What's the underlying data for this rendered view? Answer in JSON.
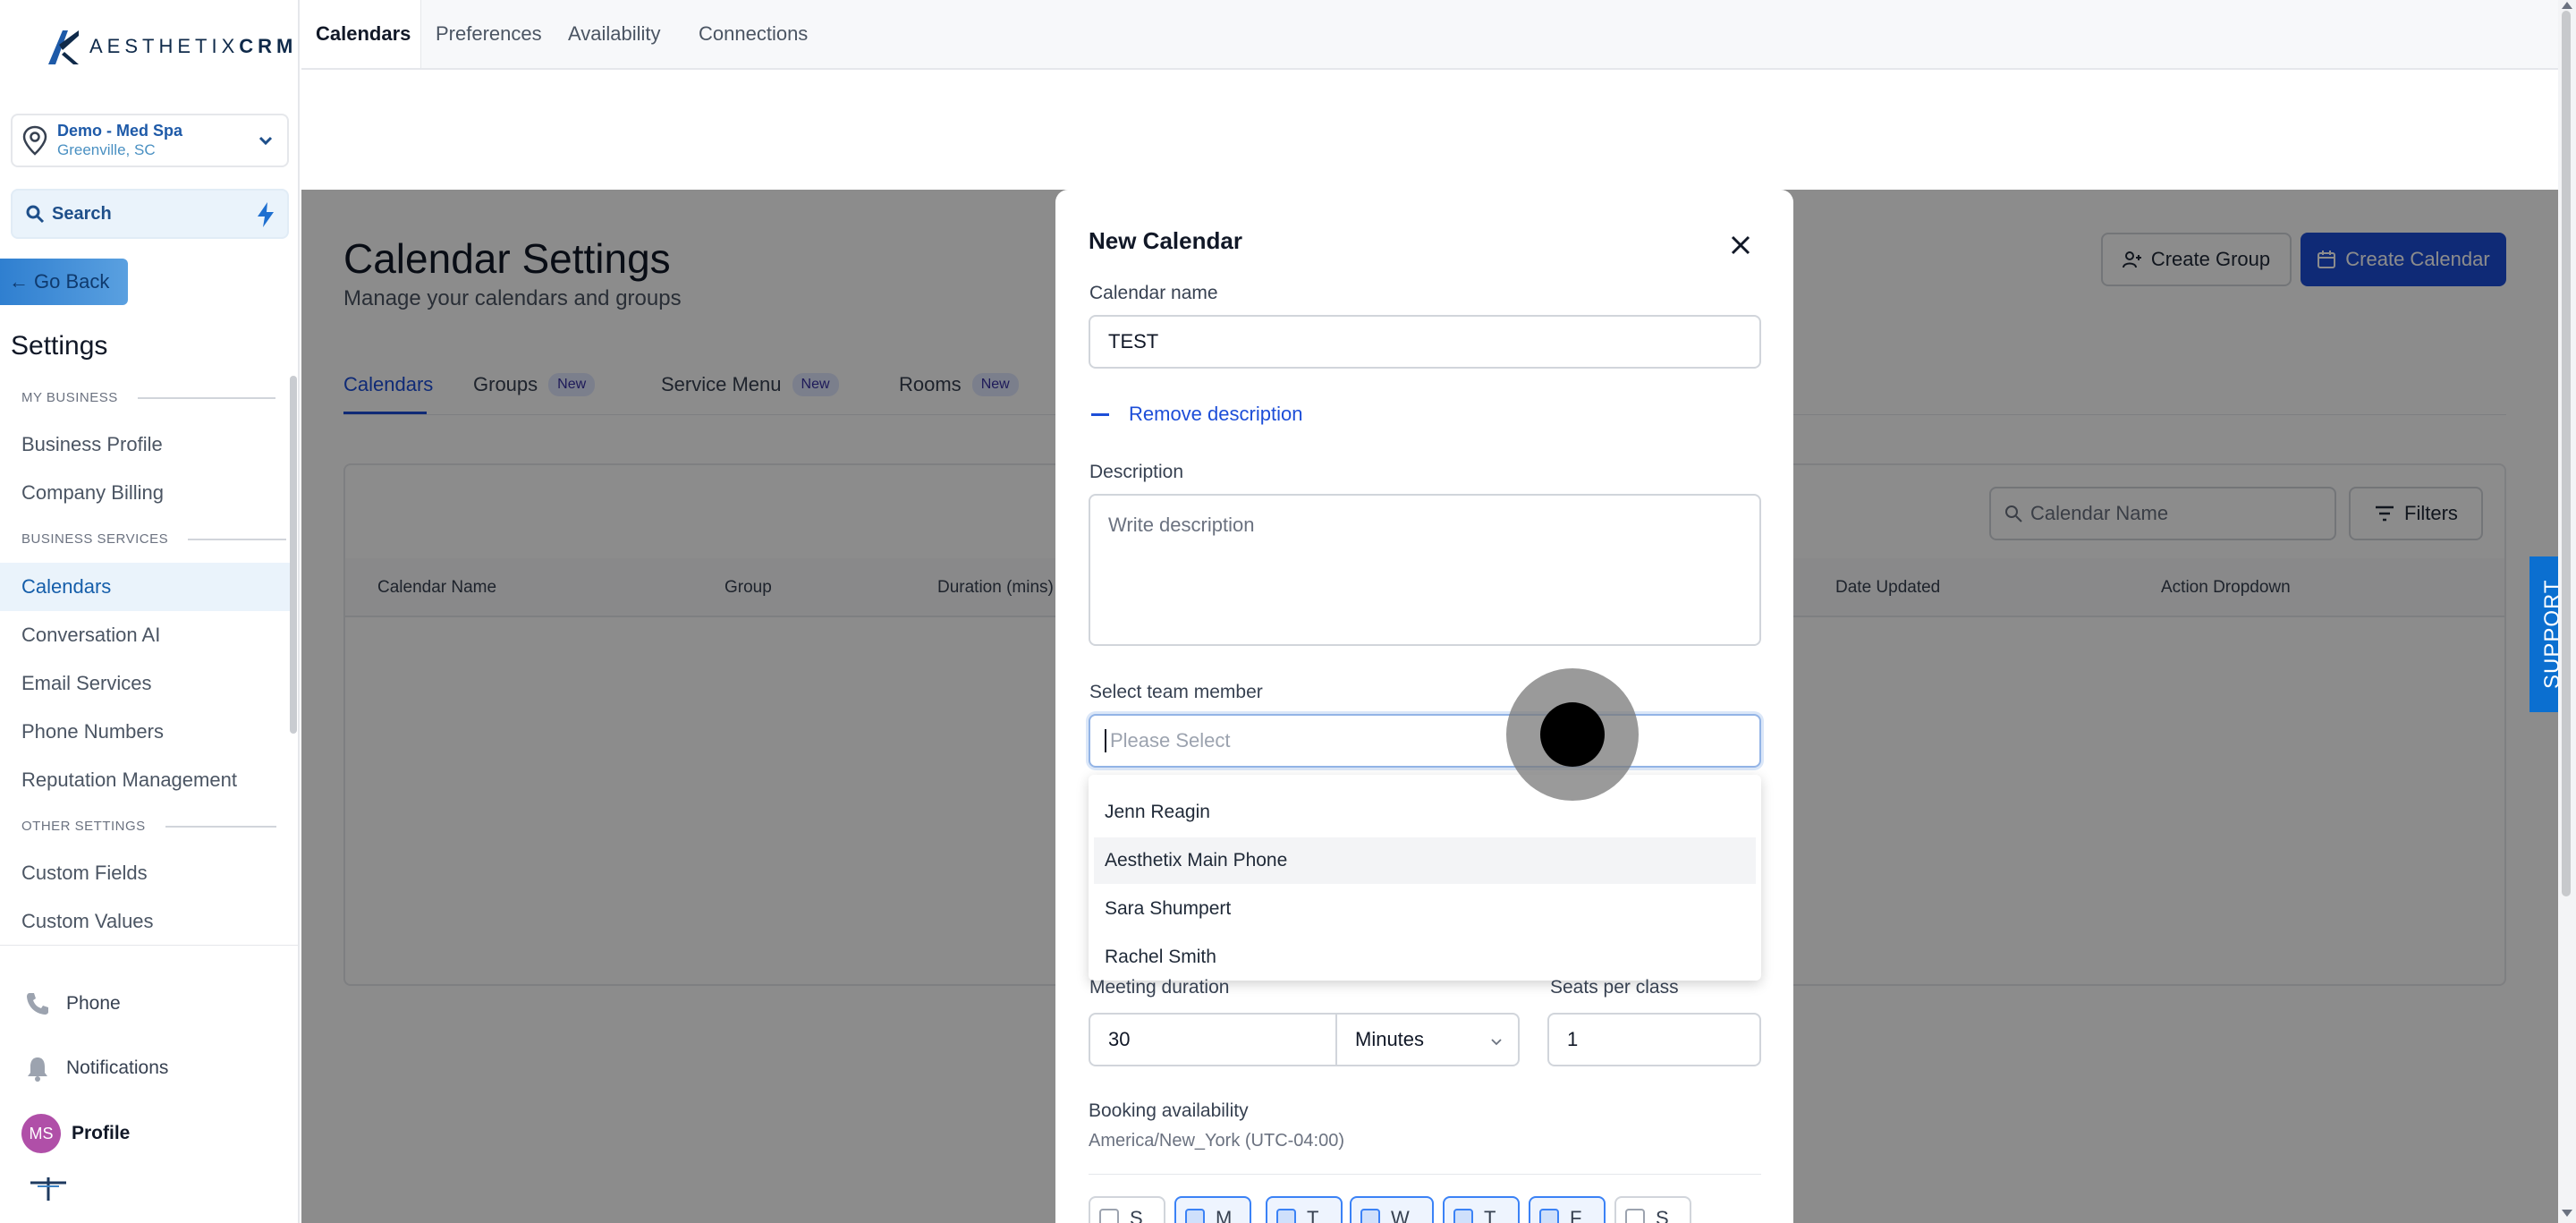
{
  "brand": {
    "name_light": "AESTHETIX",
    "name_bold": "CRM"
  },
  "location": {
    "name": "Demo - Med Spa",
    "city": "Greenville, SC"
  },
  "search": {
    "label": "Search"
  },
  "go_back": {
    "label": "Go Back"
  },
  "sidebar": {
    "title": "Settings",
    "sections": [
      {
        "label": "MY BUSINESS",
        "items": [
          "Business Profile",
          "Company Billing"
        ]
      },
      {
        "label": "BUSINESS SERVICES",
        "items": [
          "Calendars",
          "Conversation AI",
          "Email Services",
          "Phone Numbers",
          "Reputation Management"
        ]
      },
      {
        "label": "OTHER SETTINGS",
        "items": [
          "Custom Fields",
          "Custom Values"
        ]
      }
    ],
    "active_item": "Calendars",
    "bottom": {
      "phone": "Phone",
      "notifications": "Notifications",
      "profile": "Profile",
      "avatar_initials": "MS"
    }
  },
  "top_tabs": [
    "Calendars",
    "Preferences",
    "Availability",
    "Connections"
  ],
  "page": {
    "title": "Calendar Settings",
    "subtitle": "Manage your calendars and groups",
    "create_group": "Create Group",
    "create_calendar": "Create Calendar",
    "tabs": [
      {
        "label": "Calendars",
        "badge": ""
      },
      {
        "label": "Groups",
        "badge": "New"
      },
      {
        "label": "Service Menu",
        "badge": "New"
      },
      {
        "label": "Rooms",
        "badge": "New"
      }
    ],
    "search_placeholder": "Calendar Name",
    "filters": "Filters",
    "columns": [
      "Calendar Name",
      "Group",
      "Duration (mins)",
      "Date Updated",
      "Action Dropdown"
    ]
  },
  "support": "SUPPORT",
  "modal": {
    "title": "New Calendar",
    "calendar_name_label": "Calendar name",
    "calendar_name_value": "TEST",
    "remove_description": "Remove description",
    "description_label": "Description",
    "description_placeholder": "Write description",
    "team_member_label": "Select team member",
    "team_member_placeholder": "Please Select",
    "team_members": [
      "Jenn Reagin",
      "Aesthetix Main Phone",
      "Sara Shumpert",
      "Rachel Smith"
    ],
    "hovered_member": "Aesthetix Main Phone",
    "meeting_duration_label": "Meeting duration",
    "meeting_duration_value": "30",
    "duration_unit": "Minutes",
    "seats_label": "Seats per class",
    "seats_value": "1",
    "booking_label": "Booking availability",
    "timezone": "America/New_York (UTC-04:00)",
    "days": [
      {
        "letter": "S",
        "checked": false
      },
      {
        "letter": "M",
        "checked": true
      },
      {
        "letter": "T",
        "checked": true
      },
      {
        "letter": "W",
        "checked": true
      },
      {
        "letter": "T",
        "checked": true
      },
      {
        "letter": "F",
        "checked": true
      },
      {
        "letter": "S",
        "checked": false
      }
    ]
  },
  "colors": {
    "accent": "#1d4ed8",
    "brand_dark": "#0f2a4a",
    "avatar": "#b04fa8",
    "support": "#0b6fd0"
  }
}
